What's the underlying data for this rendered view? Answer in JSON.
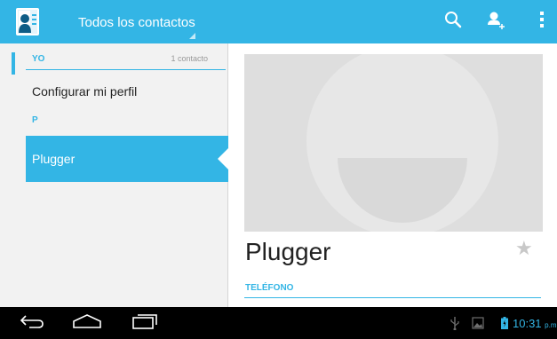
{
  "action_bar": {
    "spinner_label": "Todos los contactos",
    "accent_color": "#33b5e5",
    "icons": [
      "contacts-app-icon",
      "search-icon",
      "add-contact-icon",
      "overflow-menu-icon"
    ]
  },
  "contact_list": {
    "sections": [
      {
        "title": "YO",
        "count": "1 contacto"
      },
      {
        "title": "P"
      }
    ],
    "profile_item": "Configurar mi perfil",
    "contacts": [
      {
        "name": "Plugger",
        "selected": true
      }
    ]
  },
  "detail": {
    "name": "Plugger",
    "phone_section": "TELÉFONO",
    "favorite": false
  },
  "system_bar": {
    "time": "10:31",
    "time_suffix": "p.m.",
    "icons": [
      "back-icon",
      "home-icon",
      "recent-apps-icon",
      "usb-icon",
      "image-notification-icon",
      "battery-icon"
    ]
  }
}
